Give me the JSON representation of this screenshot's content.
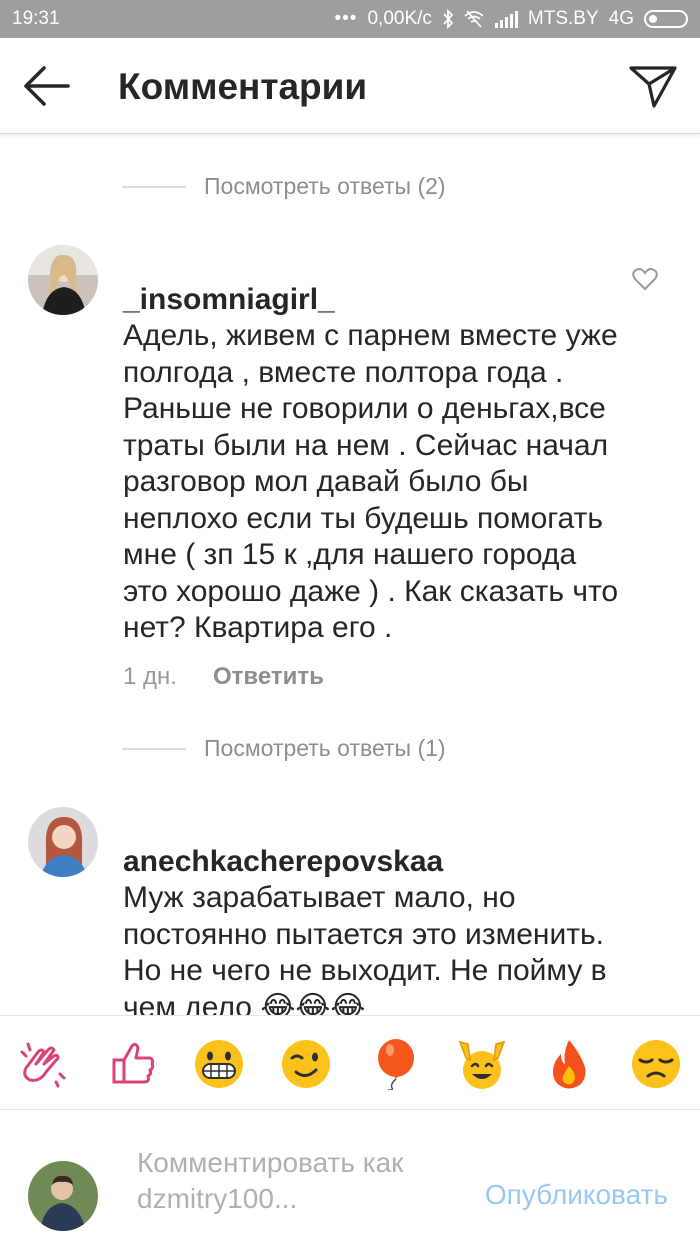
{
  "status_bar": {
    "time": "19:31",
    "speed": "0,00K/c",
    "carrier": "MTS.BY",
    "network": "4G",
    "icons": [
      "dots-icon",
      "bluetooth-icon",
      "wifi-off-icon",
      "signal-icon",
      "battery-icon"
    ]
  },
  "header": {
    "title": "Комментарии",
    "back_icon": "arrow-left-icon",
    "send_icon": "paper-plane-icon"
  },
  "comments": [
    {
      "view_replies": "Посмотреть ответы (2)",
      "username": "_insomniagirl_",
      "text": "Адель, живем с парнем вместе уже полгода , вместе полтора года . Раньше не говорили о деньгах,все траты были на нем . Сейчас начал разговор мол давай было бы неплохо если ты будешь помогать мне ( зп 15 к ,для нашего города это хорошо даже ) . Как сказать что нет? Квартира его .",
      "time": "1 дн.",
      "reply_label": "Ответить"
    },
    {
      "view_replies": "Посмотреть ответы (1)",
      "username": "anechkacherepovskaa",
      "text": "Муж зарабатывает мало, но постоянно пытается это изменить. Но не чего не выходит. Не пойму в чем дело 😂😂😂"
    }
  ],
  "emoji_bar": [
    "👏",
    "👍",
    "😁",
    "😉",
    "🎈",
    "🙌",
    "🔥",
    "😞"
  ],
  "composer": {
    "placeholder": "Комментировать как dzmitry100...",
    "publish_label": "Опубликовать"
  },
  "colors": {
    "status_bar": "#9e9e9e",
    "text": "#262626",
    "muted": "#8e8e8e",
    "link_disabled": "#99c8f0"
  }
}
